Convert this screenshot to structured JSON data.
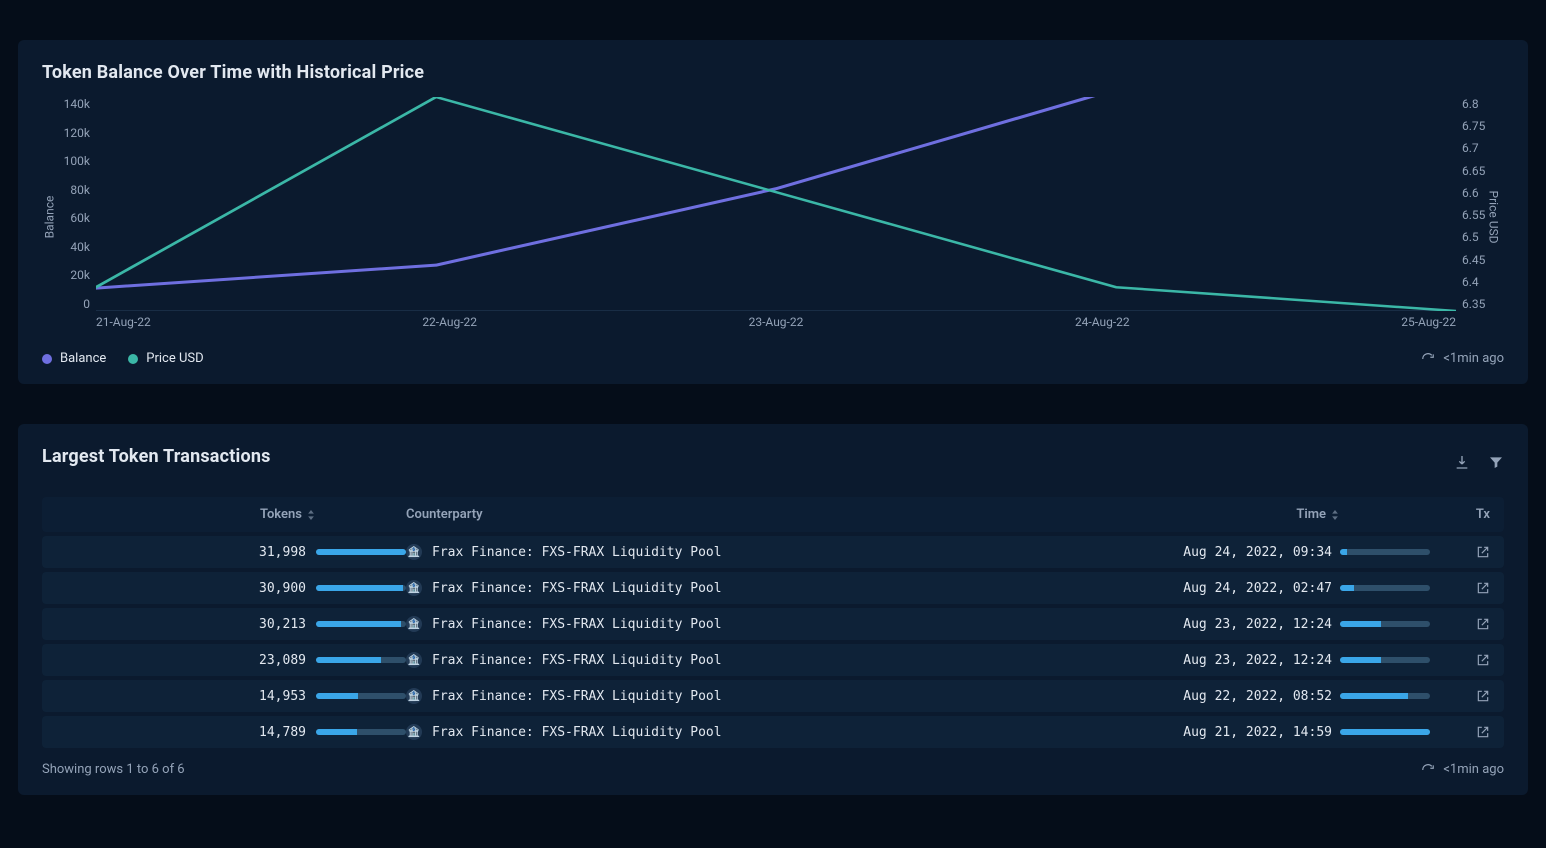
{
  "chart": {
    "title": "Token Balance Over Time with Historical Price",
    "y_left_label": "Balance",
    "y_right_label": "Price USD",
    "y_left_ticks": [
      "140k",
      "120k",
      "100k",
      "80k",
      "60k",
      "40k",
      "20k",
      "0"
    ],
    "y_right_ticks": [
      "6.8",
      "6.75",
      "6.7",
      "6.65",
      "6.6",
      "6.55",
      "6.5",
      "6.45",
      "6.4",
      "6.35"
    ],
    "x_ticks": [
      "21-Aug-22",
      "22-Aug-22",
      "23-Aug-22",
      "24-Aug-22",
      "25-Aug-22"
    ],
    "legend": {
      "balance": "Balance",
      "price": "Price USD"
    },
    "refresh": "<1min ago"
  },
  "chart_data": {
    "type": "line",
    "x": [
      "21-Aug-22",
      "22-Aug-22",
      "23-Aug-22",
      "24-Aug-22",
      "25-Aug-22"
    ],
    "series": [
      {
        "name": "Balance",
        "axis": "left",
        "values": [
          15000,
          30000,
          80000,
          145000,
          145000
        ]
      },
      {
        "name": "Price USD",
        "axis": "right",
        "values": [
          6.4,
          6.8,
          6.6,
          6.4,
          6.35
        ]
      }
    ],
    "y_left": {
      "label": "Balance",
      "range": [
        0,
        140000
      ]
    },
    "y_right": {
      "label": "Price USD",
      "range": [
        6.35,
        6.8
      ]
    },
    "title": "Token Balance Over Time with Historical Price"
  },
  "table": {
    "title": "Largest Token Transactions",
    "columns": {
      "tokens": "Tokens",
      "counterparty": "Counterparty",
      "time": "Time",
      "tx": "Tx"
    },
    "rows": [
      {
        "tokens": "31,998",
        "tokens_frac": 1.0,
        "counterparty": "Frax Finance: FXS-FRAX Liquidity Pool",
        "time": "Aug 24, 2022, 09:34",
        "time_frac": 0.08
      },
      {
        "tokens": "30,900",
        "tokens_frac": 0.97,
        "counterparty": "Frax Finance: FXS-FRAX Liquidity Pool",
        "time": "Aug 24, 2022, 02:47",
        "time_frac": 0.15
      },
      {
        "tokens": "30,213",
        "tokens_frac": 0.94,
        "counterparty": "Frax Finance: FXS-FRAX Liquidity Pool",
        "time": "Aug 23, 2022, 12:24",
        "time_frac": 0.45
      },
      {
        "tokens": "23,089",
        "tokens_frac": 0.72,
        "counterparty": "Frax Finance: FXS-FRAX Liquidity Pool",
        "time": "Aug 23, 2022, 12:24",
        "time_frac": 0.45
      },
      {
        "tokens": "14,953",
        "tokens_frac": 0.47,
        "counterparty": "Frax Finance: FXS-FRAX Liquidity Pool",
        "time": "Aug 22, 2022, 08:52",
        "time_frac": 0.75
      },
      {
        "tokens": "14,789",
        "tokens_frac": 0.46,
        "counterparty": "Frax Finance: FXS-FRAX Liquidity Pool",
        "time": "Aug 21, 2022, 14:59",
        "time_frac": 1.0
      }
    ],
    "footer": "Showing rows 1 to 6 of 6",
    "refresh": "<1min ago"
  }
}
